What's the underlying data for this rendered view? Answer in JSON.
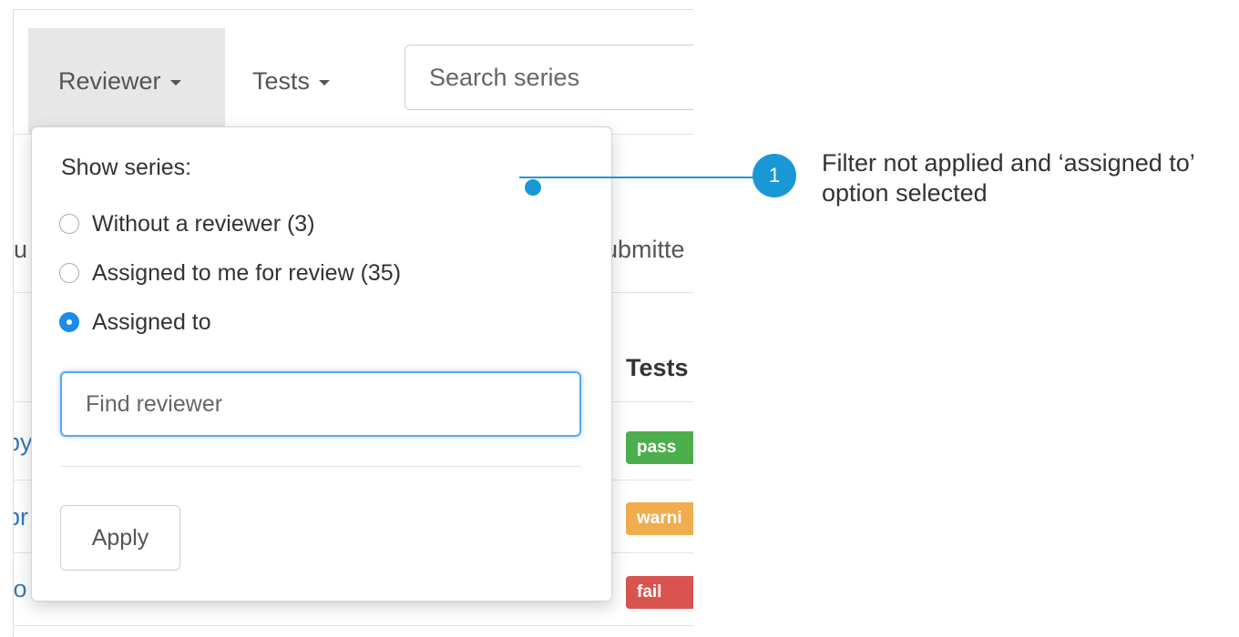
{
  "navbar": {
    "reviewer_label": "Reviewer",
    "tests_label": "Tests",
    "search_placeholder": "Search series"
  },
  "background": {
    "col_fragment_left": "u",
    "col_fragment_right": "ubmitte",
    "tests_header": "Tests",
    "row_links": [
      "py",
      "pr",
      "fo"
    ],
    "badges": [
      {
        "label": "pass",
        "color": "#4cae4c"
      },
      {
        "label": "warni",
        "color": "#efad4d"
      },
      {
        "label": "fail",
        "color": "#d9534f"
      }
    ]
  },
  "dropdown": {
    "heading": "Show series:",
    "options": [
      {
        "label": "Without a reviewer (3)",
        "checked": false
      },
      {
        "label": "Assigned to me for review (35)",
        "checked": false
      },
      {
        "label": "Assigned to",
        "checked": true
      }
    ],
    "find_placeholder": "Find reviewer",
    "apply_label": "Apply"
  },
  "annotation": {
    "number": "1",
    "text": "Filter not applied and ‘assigned to’ option selected",
    "color": "#1a98d5"
  },
  "colors": {
    "accent": "#1a8be8",
    "link": "#337ab7"
  }
}
